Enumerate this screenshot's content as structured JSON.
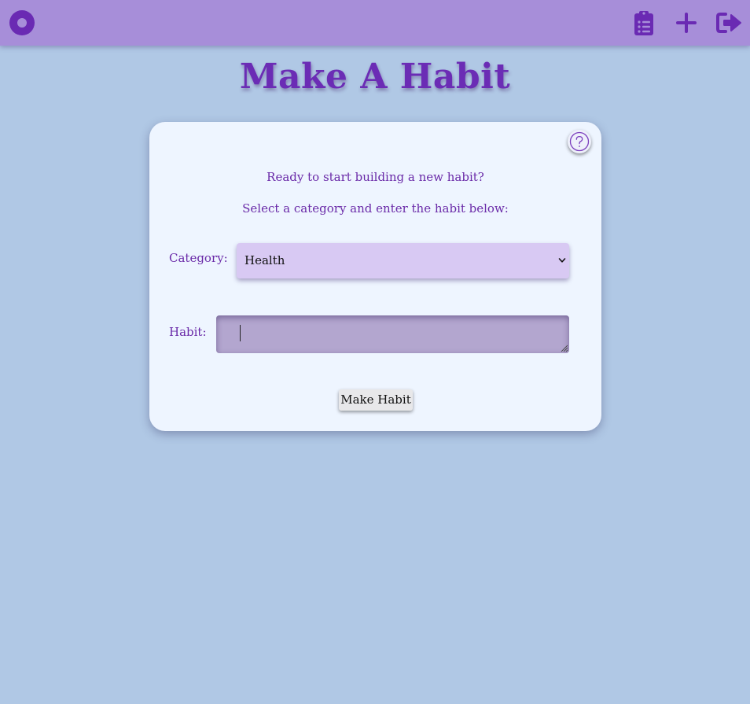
{
  "navbar": {
    "logo_icon": "circle-logo-icon",
    "actions": [
      {
        "name": "clipboard-list-icon"
      },
      {
        "name": "plus-icon"
      },
      {
        "name": "logout-icon"
      }
    ],
    "icon_color": "#6a2ab3",
    "background": "#a78ed9"
  },
  "page": {
    "title": "Make A Habit",
    "background": "#b0c8e5"
  },
  "card": {
    "help_icon": "question-mark-icon",
    "intro_line_1": "Ready to start building a new habit?",
    "intro_line_2": "Select a category and enter the habit below:",
    "category_label": "Category:",
    "category_selected": "Health",
    "habit_label": "Habit:",
    "habit_value": "",
    "submit_label": "Make Habit"
  }
}
